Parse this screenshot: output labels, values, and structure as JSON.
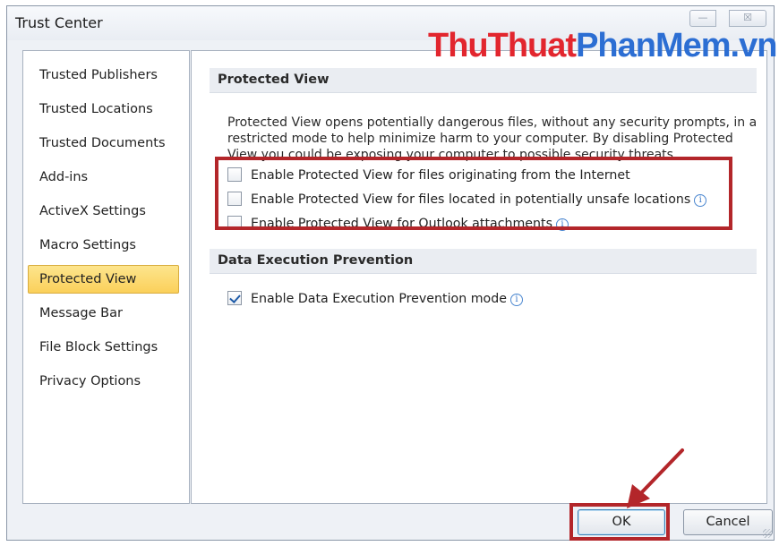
{
  "window": {
    "title": "Trust Center"
  },
  "watermark": {
    "part1": "ThuThuat",
    "part2": "PhanMem.vn",
    "colors": [
      "#e2262e",
      "#2c6ed3"
    ]
  },
  "sidebar": {
    "items": [
      {
        "label": "Trusted Publishers",
        "active": false
      },
      {
        "label": "Trusted Locations",
        "active": false
      },
      {
        "label": "Trusted Documents",
        "active": false
      },
      {
        "label": "Add-ins",
        "active": false
      },
      {
        "label": "ActiveX Settings",
        "active": false
      },
      {
        "label": "Macro Settings",
        "active": false
      },
      {
        "label": "Protected View",
        "active": true
      },
      {
        "label": "Message Bar",
        "active": false
      },
      {
        "label": "File Block Settings",
        "active": false
      },
      {
        "label": "Privacy Options",
        "active": false
      }
    ]
  },
  "protected_view": {
    "heading": "Protected View",
    "description": "Protected View opens potentially dangerous files, without any security prompts, in a restricted mode to help minimize harm to your computer. By disabling Protected View you could be exposing your computer to possible security threats.",
    "options": [
      {
        "label": "Enable Protected View for files originating from the Internet",
        "checked": false,
        "info": false
      },
      {
        "label": "Enable Protected View for files located in potentially unsafe locations",
        "checked": false,
        "info": true
      },
      {
        "label": "Enable Protected View for Outlook attachments",
        "checked": false,
        "info": true
      }
    ]
  },
  "dep": {
    "heading": "Data Execution Prevention",
    "option": {
      "label": "Enable Data Execution Prevention mode",
      "checked": true,
      "info": true
    }
  },
  "buttons": {
    "ok": "OK",
    "cancel": "Cancel"
  },
  "icons": {
    "info": "i",
    "minimize": "—",
    "close": "☒"
  },
  "colors": {
    "highlight": "#b3262a",
    "active_item": "#fbd05a",
    "accent": "#1d5aa8"
  }
}
